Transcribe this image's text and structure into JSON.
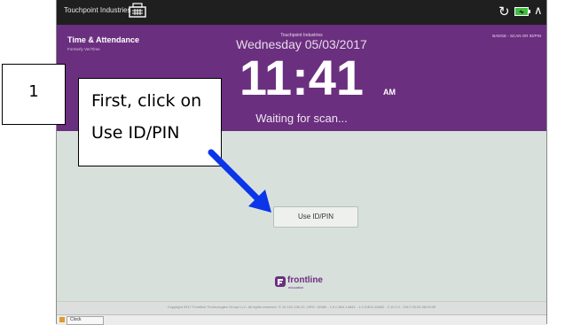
{
  "topbar": {
    "org_name": "Touchpoint Industries",
    "icons": [
      "kiosk-icon",
      "refresh-icon",
      "battery-icon",
      "chevron-up-icon"
    ]
  },
  "header": {
    "app_title": "Time & Attendance",
    "app_subtitle": "Formerly VeriTime",
    "org_name": "Touchpoint Industries",
    "date": "Wednesday 05/03/2017",
    "time": "11:41",
    "ampm": "AM",
    "status": "Waiting for scan...",
    "scan_hint": "BADGE - SCAN OR ID/PIN"
  },
  "content": {
    "use_id_button_label": "Use ID/PIN",
    "brand_name": "frontline",
    "brand_tag": "education"
  },
  "footer": {
    "copyright": "Copyright 2017 Frontline Technologies Group LLC. All rights reserved. © 10.102.136.22, ORG: 14580 - 1.0.0.804.14841 - 1.0.0.804.14862 - 2.11.0.0 - 2017.05.03-08:09:05"
  },
  "taskbar": {
    "item_label": "Clock"
  },
  "annotation": {
    "step_number": "1",
    "instruction_line1": "First, click on",
    "instruction_line2": "Use ID/PIN"
  },
  "colors": {
    "header_purple": "#6b2f7f",
    "topbar": "#1f1f1f",
    "content_bg": "#d8e0dc",
    "battery_green": "#3fbf3f",
    "arrow_blue": "#0a35e8"
  }
}
